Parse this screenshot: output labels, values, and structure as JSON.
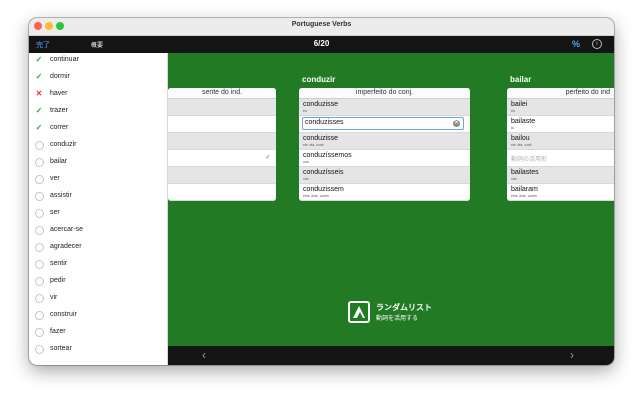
{
  "window": {
    "title": "Portuguese Verbs"
  },
  "toolbar": {
    "done": "完了",
    "overview": "概要",
    "counter": "6/20",
    "percent": "%",
    "info": "i"
  },
  "sidebar": {
    "items": [
      {
        "label": "continuar",
        "status": "correct"
      },
      {
        "label": "dormir",
        "status": "correct"
      },
      {
        "label": "haver",
        "status": "wrong"
      },
      {
        "label": "trazer",
        "status": "correct"
      },
      {
        "label": "correr",
        "status": "correct"
      },
      {
        "label": "conduzir",
        "status": "none"
      },
      {
        "label": "bailar",
        "status": "none"
      },
      {
        "label": "ver",
        "status": "none"
      },
      {
        "label": "assistir",
        "status": "none"
      },
      {
        "label": "ser",
        "status": "none"
      },
      {
        "label": "acercar-se",
        "status": "none"
      },
      {
        "label": "agradecer",
        "status": "none"
      },
      {
        "label": "sentir",
        "status": "none"
      },
      {
        "label": "pedir",
        "status": "none"
      },
      {
        "label": "vir",
        "status": "none"
      },
      {
        "label": "construir",
        "status": "none"
      },
      {
        "label": "fazer",
        "status": "none"
      },
      {
        "label": "sortear",
        "status": "none"
      }
    ]
  },
  "cards": {
    "left": {
      "tense": "sente do ind."
    },
    "center": {
      "verb": "conduzir",
      "tense": "imperfeito do conj.",
      "rows": [
        {
          "form": "conduzisse",
          "pron": "eu"
        },
        {
          "form": "conduzisses",
          "pron": ""
        },
        {
          "form": "conduzisse",
          "pron": "ele, ela, você"
        },
        {
          "form": "conduzíssemos",
          "pron": "nós"
        },
        {
          "form": "conduzísseis",
          "pron": "vós"
        },
        {
          "form": "conduzissem",
          "pron": "eles, elas, vocês"
        }
      ]
    },
    "right": {
      "verb": "bailar",
      "tense": "perfeito do ind",
      "rows": [
        {
          "form": "bailei",
          "pron": "eu"
        },
        {
          "form": "bailaste",
          "pron": "tu"
        },
        {
          "form": "bailou",
          "pron": "ele, ela, você"
        },
        {
          "form": "",
          "pron": "",
          "placeholder": "動詞の活用形"
        },
        {
          "form": "bailastes",
          "pron": "vós"
        },
        {
          "form": "bailaram",
          "pron": "eles, elas, vocês"
        }
      ]
    }
  },
  "promo": {
    "title": "ランダムリスト",
    "subtitle": "動詞を活用する"
  },
  "nav": {
    "prev": "‹",
    "next": "›"
  },
  "colors": {
    "background": "#237a25",
    "accent": "#4da3ff",
    "correct": "#2fa737",
    "wrong": "#e23a34"
  }
}
